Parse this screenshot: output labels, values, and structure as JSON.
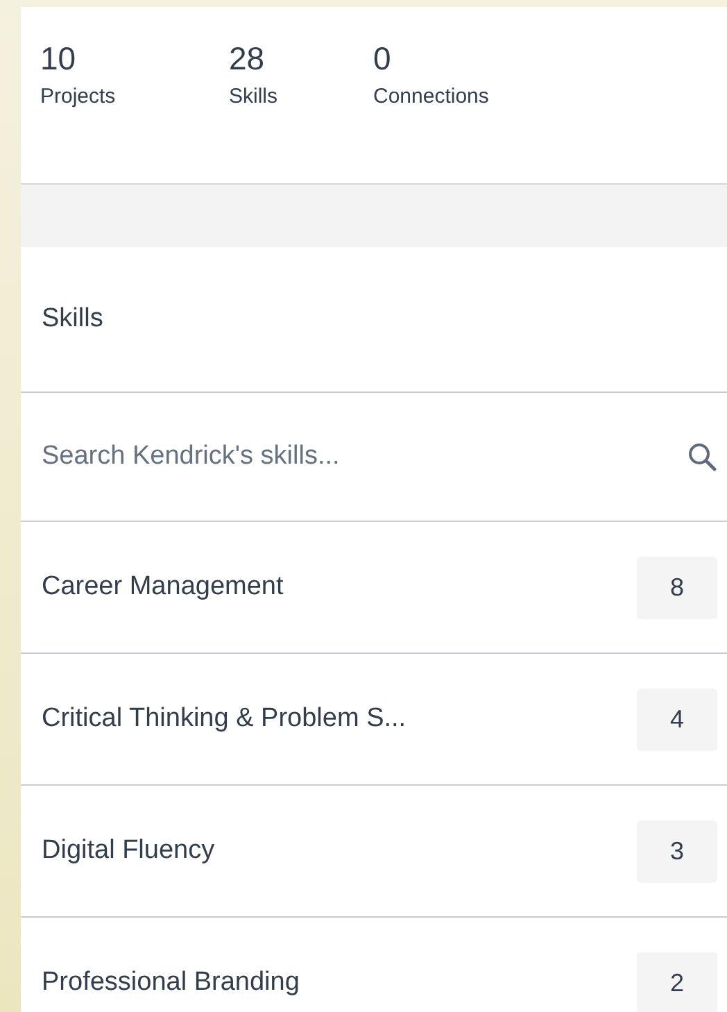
{
  "stats": [
    {
      "value": "10",
      "label": "Projects"
    },
    {
      "value": "28",
      "label": "Skills"
    },
    {
      "value": "0",
      "label": "Connections"
    }
  ],
  "skills_panel": {
    "title": "Skills",
    "search": {
      "placeholder": "Search Kendrick's skills..."
    },
    "items": [
      {
        "name": "Career Management",
        "count": "8"
      },
      {
        "name": "Critical Thinking & Problem S...",
        "count": "4"
      },
      {
        "name": "Digital Fluency",
        "count": "3"
      },
      {
        "name": "Professional Branding",
        "count": "2"
      }
    ]
  }
}
